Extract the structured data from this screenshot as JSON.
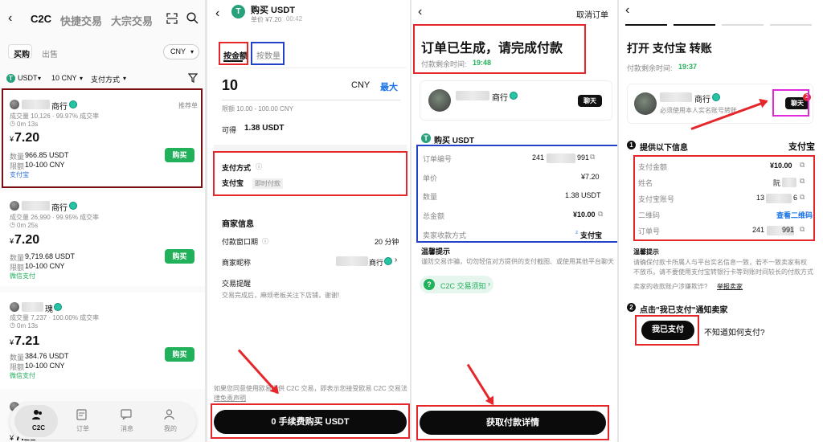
{
  "panel1": {
    "tabs": [
      "C2C",
      "快捷交易",
      "大宗交易"
    ],
    "buy_tab": "买购",
    "sell_tab": "出售",
    "currency": "CNY",
    "filter_coin": "USDT",
    "filter_amount": "10 CNY",
    "filter_payment": "支付方式",
    "listings": [
      {
        "suffix": "商行",
        "stats": "成交量 10,126 · 99.97% 成交率",
        "time": "0m 13s",
        "tag": "推荐单",
        "price": "7.20",
        "qty_label": "数量",
        "qty": "966.85 USDT",
        "limit_label": "限额",
        "limit": "10-100 CNY",
        "pay": "支付宝",
        "btn": "购买"
      },
      {
        "suffix": "商行",
        "stats": "成交量 26,990 · 99.95% 成交率",
        "time": "0m 25s",
        "tag": "",
        "price": "7.20",
        "qty_label": "数量",
        "qty": "9,719.68 USDT",
        "limit_label": "限额",
        "limit": "10-100 CNY",
        "pay": "微信支付",
        "btn": "购买"
      },
      {
        "suffix": "瑰",
        "stats": "成交量 7,237 · 100.00% 成交率",
        "time": "0m 13s",
        "tag": "",
        "price": "7.21",
        "qty_label": "数量",
        "qty": "384.76 USDT",
        "limit_label": "限额",
        "limit": "10-100 CNY",
        "pay": "微信支付",
        "btn": "购买"
      }
    ],
    "last_price": "7.21",
    "currency_symbol": "¥",
    "nav": [
      "C2C",
      "订单",
      "消息",
      "我的"
    ]
  },
  "panel2": {
    "title": "购买 USDT",
    "unit_price": "单价 ¥7.20",
    "countdown": "00:42",
    "tab_amount": "按金额",
    "tab_qty": "按数量",
    "amount": "10",
    "currency": "CNY",
    "max": "最大",
    "limit": "限额 10.00 - 100.00 CNY",
    "get_label": "可得",
    "get_value": "1.38 USDT",
    "pay_method_label": "支付方式",
    "pay_method": "支付宝",
    "pay_tag": "即时付款",
    "merchant_info": "商家信息",
    "window_label": "付款窗口期",
    "window_value": "20 分钟",
    "nickname_label": "商家昵称",
    "nickname_suffix": "商行",
    "remind_label": "交易提醒",
    "remind_text": "交易完成后，麻烦老板关注下店铺，谢谢!",
    "agree_text_1": "如果您同意使用欧易提供 C2C 交易，即表示您接受欧易 C2C 交易法",
    "agree_text_2": "律免责声明",
    "buy_btn": "0 手续费购买 USDT"
  },
  "panel3": {
    "cancel": "取消订单",
    "headline": "订单已生成，请完成付款",
    "remain_label": "付款剩余时间:",
    "remain": "19:48",
    "seller_suffix": "商行",
    "chat": "聊天",
    "buy_label": "购买 USDT",
    "rows": [
      {
        "label": "订单编号",
        "value": "241",
        "value2": "991"
      },
      {
        "label": "单价",
        "value": "¥7.20"
      },
      {
        "label": "数量",
        "value": "1.38 USDT"
      },
      {
        "label": "总金额",
        "value": "¥10.00"
      },
      {
        "label": "卖家收款方式",
        "value": "支付宝"
      }
    ],
    "tip_title": "温馨提示",
    "tip_text": "谨防交易诈骗，切勿轻信对方提供的支付截图、或使用其他平台聊天",
    "notice": "C2C 交易须知",
    "detail_btn": "获取付款详情"
  },
  "panel4": {
    "headline": "打开 支付宝 转账",
    "remain_label": "付款剩余时间:",
    "remain": "19:37",
    "seller_suffix": "商行",
    "seller_note": "必须使用本人实名账号转账",
    "chat": "聊天",
    "chat_badge": "2",
    "step1": "提供以下信息",
    "step1_method": "支付宝",
    "rows": [
      {
        "label": "支付金额",
        "value": "¥10.00"
      },
      {
        "label": "姓名",
        "value": "阮"
      },
      {
        "label": "支付宝账号",
        "value": "13",
        "value2": "6"
      },
      {
        "label": "二维码",
        "value": "查看二维码"
      },
      {
        "label": "订单号",
        "value": "241",
        "value2": "991"
      }
    ],
    "tip_title": "温馨提示",
    "tip_text_1": "请确保付款卡所属人与平台实名信息一致，若不一致卖家有权",
    "tip_text_2": "不放币。请不要使用支付宝转银行卡等到账时间较长的付款方式",
    "tip_text_3": "卖家的收款账户涉嫌欺诈?",
    "tip_link": "举报卖家",
    "step2": "点击\"我已支付\"通知卖家",
    "paid_btn": "我已支付",
    "how_pay": "不知道如何支付?"
  },
  "colors": {
    "red": "#e5262b",
    "blue": "#2342c9",
    "pink": "#e02ad9",
    "green": "#21b15a",
    "tether": "#26a17b"
  }
}
